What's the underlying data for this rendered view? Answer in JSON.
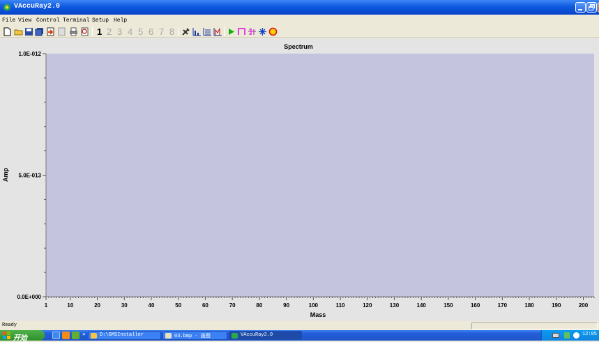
{
  "window": {
    "title": "VAccuRay2.0"
  },
  "menu": [
    "File",
    "View",
    "Control",
    "Terminal",
    "Setup",
    "Help"
  ],
  "toolbar": {
    "numbers": [
      "1",
      "2",
      "3",
      "4",
      "5",
      "6",
      "7",
      "8"
    ],
    "active_number": "1"
  },
  "chart_data": {
    "type": "line",
    "title": "Spectrum",
    "xlabel": "Mass",
    "ylabel": "Amp",
    "x_ticks": [
      "1",
      "10",
      "20",
      "30",
      "40",
      "50",
      "60",
      "70",
      "80",
      "90",
      "100",
      "110",
      "120",
      "130",
      "140",
      "150",
      "160",
      "170",
      "180",
      "190",
      "200"
    ],
    "y_ticks": [
      "1.0E-012",
      "5.0E-013",
      "0.0E+000"
    ],
    "xlim": [
      1,
      204
    ],
    "ylim": [
      0,
      1e-12
    ],
    "series": [],
    "plot_color": "#C5C4DE"
  },
  "statusbar": {
    "text": "Ready"
  },
  "taskbar": {
    "start_label": "开始",
    "tasks": [
      {
        "label": "D:\\GMSInstaller",
        "icon": "folder-icon",
        "active": false
      },
      {
        "label": "03.bmp - 画图",
        "icon": "paint-icon",
        "active": false
      },
      {
        "label": "VAccuRay2.0",
        "icon": "app-icon",
        "active": true
      }
    ],
    "clock": "12:05"
  }
}
